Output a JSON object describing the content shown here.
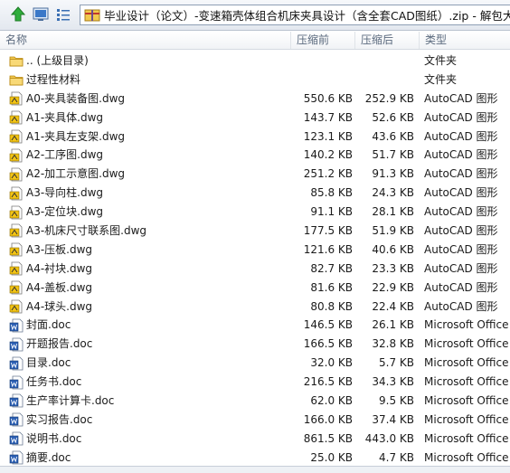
{
  "path": {
    "text": "毕业设计（论文）-变速箱壳体组合机床夹具设计（含全套CAD图纸）.zip - 解包大小为"
  },
  "toolbar": {
    "icons": [
      "up-arrow-icon",
      "view-icon",
      "list-view-icon"
    ]
  },
  "columns": {
    "name": "名称",
    "size": "压缩前",
    "packed": "压缩后",
    "type": "类型"
  },
  "files": [
    {
      "name": ".. (上级目录)",
      "size": "",
      "packed": "",
      "type": "文件夹",
      "icon": "folder-icon"
    },
    {
      "name": "过程性材料",
      "size": "",
      "packed": "",
      "type": "文件夹",
      "icon": "folder-icon"
    },
    {
      "name": "A0-夹具装备图.dwg",
      "size": "550.6 KB",
      "packed": "252.9 KB",
      "type": "AutoCAD 图形",
      "icon": "dwg-file-icon"
    },
    {
      "name": "A1-夹具体.dwg",
      "size": "143.7 KB",
      "packed": "52.6 KB",
      "type": "AutoCAD 图形",
      "icon": "dwg-file-icon"
    },
    {
      "name": "A1-夹具左支架.dwg",
      "size": "123.1 KB",
      "packed": "43.6 KB",
      "type": "AutoCAD 图形",
      "icon": "dwg-file-icon"
    },
    {
      "name": "A2-工序图.dwg",
      "size": "140.2 KB",
      "packed": "51.7 KB",
      "type": "AutoCAD 图形",
      "icon": "dwg-file-icon"
    },
    {
      "name": "A2-加工示意图.dwg",
      "size": "251.2 KB",
      "packed": "91.3 KB",
      "type": "AutoCAD 图形",
      "icon": "dwg-file-icon"
    },
    {
      "name": "A3-导向柱.dwg",
      "size": "85.8 KB",
      "packed": "24.3 KB",
      "type": "AutoCAD 图形",
      "icon": "dwg-file-icon"
    },
    {
      "name": "A3-定位块.dwg",
      "size": "91.1 KB",
      "packed": "28.1 KB",
      "type": "AutoCAD 图形",
      "icon": "dwg-file-icon"
    },
    {
      "name": "A3-机床尺寸联系图.dwg",
      "size": "177.5 KB",
      "packed": "51.9 KB",
      "type": "AutoCAD 图形",
      "icon": "dwg-file-icon"
    },
    {
      "name": "A3-压板.dwg",
      "size": "121.6 KB",
      "packed": "40.6 KB",
      "type": "AutoCAD 图形",
      "icon": "dwg-file-icon"
    },
    {
      "name": "A4-衬块.dwg",
      "size": "82.7 KB",
      "packed": "23.3 KB",
      "type": "AutoCAD 图形",
      "icon": "dwg-file-icon"
    },
    {
      "name": "A4-盖板.dwg",
      "size": "81.6 KB",
      "packed": "22.9 KB",
      "type": "AutoCAD 图形",
      "icon": "dwg-file-icon"
    },
    {
      "name": "A4-球头.dwg",
      "size": "80.8 KB",
      "packed": "22.4 KB",
      "type": "AutoCAD 图形",
      "icon": "dwg-file-icon"
    },
    {
      "name": "封面.doc",
      "size": "146.5 KB",
      "packed": "26.1 KB",
      "type": "Microsoft Office",
      "icon": "doc-file-icon"
    },
    {
      "name": "开题报告.doc",
      "size": "166.5 KB",
      "packed": "32.8 KB",
      "type": "Microsoft Office",
      "icon": "doc-file-icon"
    },
    {
      "name": "目录.doc",
      "size": "32.0 KB",
      "packed": "5.7 KB",
      "type": "Microsoft Office",
      "icon": "doc-file-icon"
    },
    {
      "name": "任务书.doc",
      "size": "216.5 KB",
      "packed": "34.3 KB",
      "type": "Microsoft Office",
      "icon": "doc-file-icon"
    },
    {
      "name": "生产率计算卡.doc",
      "size": "62.0 KB",
      "packed": "9.5 KB",
      "type": "Microsoft Office",
      "icon": "doc-file-icon"
    },
    {
      "name": "实习报告.doc",
      "size": "166.0 KB",
      "packed": "37.4 KB",
      "type": "Microsoft Office",
      "icon": "doc-file-icon"
    },
    {
      "name": "说明书.doc",
      "size": "861.5 KB",
      "packed": "443.0 KB",
      "type": "Microsoft Office",
      "icon": "doc-file-icon"
    },
    {
      "name": "摘要.doc",
      "size": "25.0 KB",
      "packed": "4.7 KB",
      "type": "Microsoft Office",
      "icon": "doc-file-icon"
    }
  ]
}
